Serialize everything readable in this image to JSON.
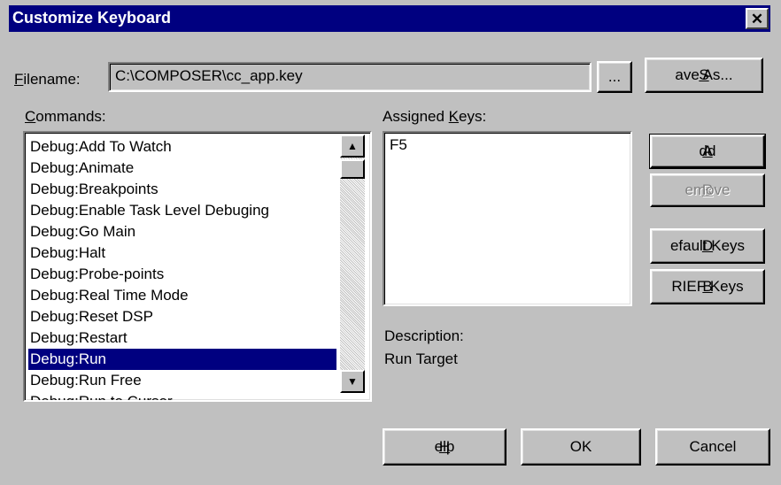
{
  "window": {
    "title": "Customize Keyboard",
    "close_glyph": "✕"
  },
  "filename": {
    "label_first": "F",
    "label_rest": "ilename:",
    "value": "C:\\COMPOSER\\cc_app.key",
    "browse_label": "...",
    "save_as_first": "S",
    "save_as_rest": "ave As..."
  },
  "commands": {
    "label_first": "C",
    "label_rest": "ommands:",
    "items": [
      "Debug:Add To Watch",
      "Debug:Animate",
      "Debug:Breakpoints",
      "Debug:Enable Task Level Debuging",
      "Debug:Go Main",
      "Debug:Halt",
      "Debug:Probe-points",
      "Debug:Real Time Mode",
      "Debug:Reset DSP",
      "Debug:Restart",
      "Debug:Run",
      "Debug:Run Free",
      "Debug:Run to Cursor"
    ],
    "selected_index": 10,
    "scroll_up_glyph": "▲",
    "scroll_down_glyph": "▼"
  },
  "assigned_keys": {
    "label_first": "Assigned ",
    "label_u": "K",
    "label_rest": "eys:",
    "items": [
      "F5"
    ]
  },
  "buttons": {
    "add_first": "A",
    "add_rest": "dd",
    "remove_first": "R",
    "remove_rest": "emove",
    "default_keys_first": "D",
    "default_keys_rest": "efault Keys",
    "brief_keys_first": "B",
    "brief_keys_rest": "RIEF Keys",
    "help_first": "H",
    "help_rest": "elp",
    "ok": "OK",
    "cancel": "Cancel"
  },
  "description": {
    "label": "Description:",
    "value": "Run Target"
  }
}
